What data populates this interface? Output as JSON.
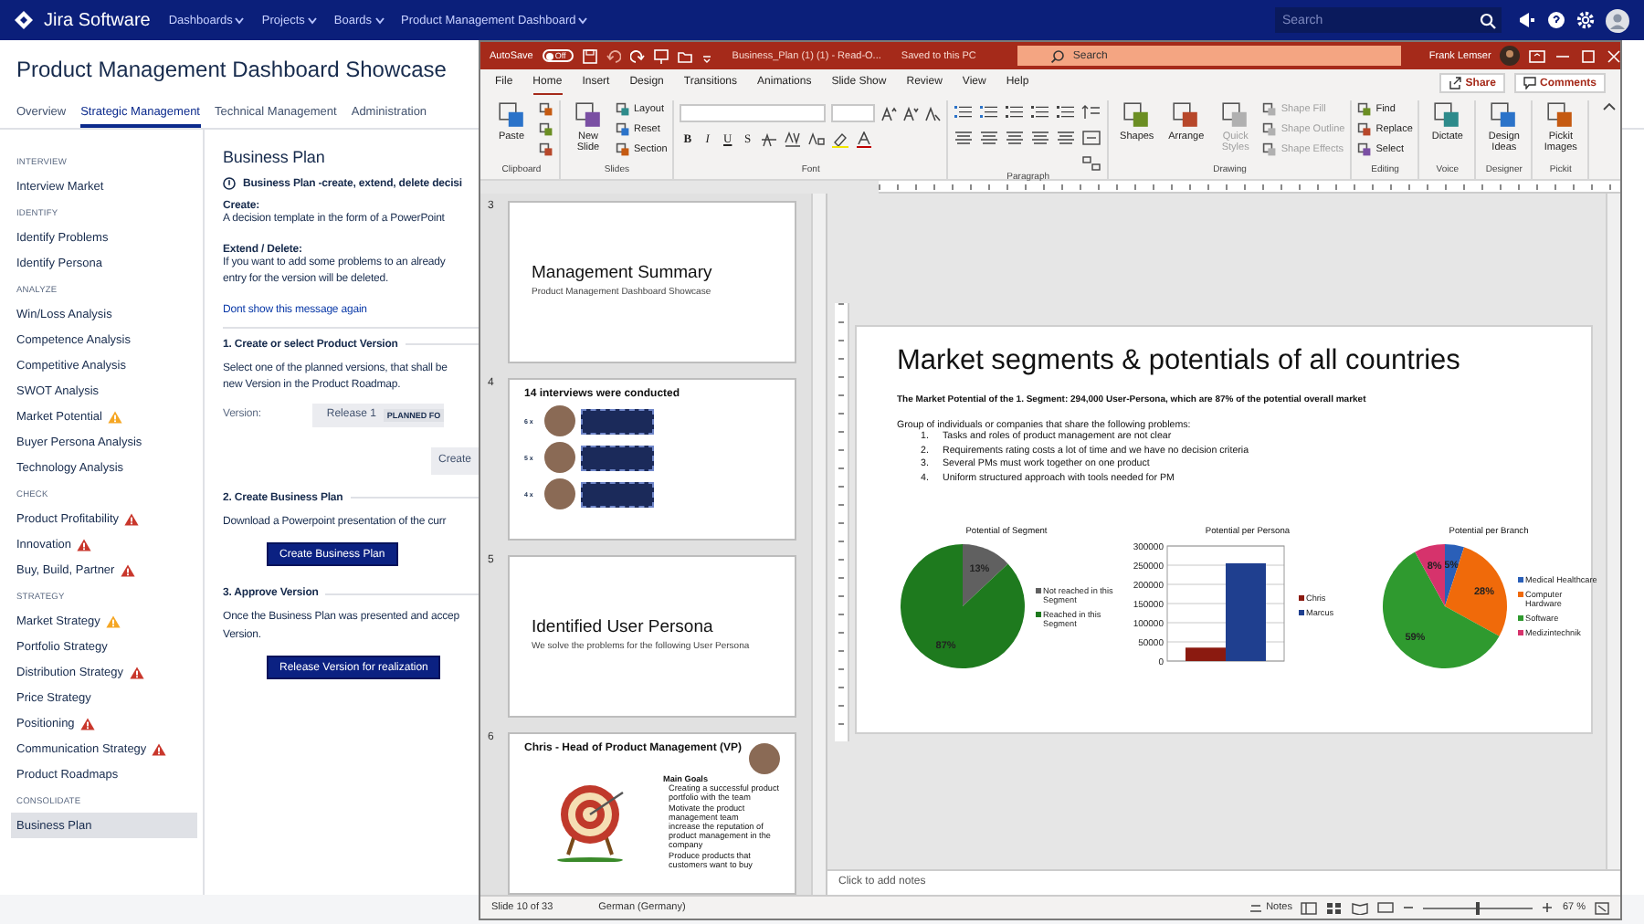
{
  "jira": {
    "header": {
      "logo": "Jira Software",
      "nav": [
        {
          "label": "Dashboards"
        },
        {
          "label": "Projects"
        },
        {
          "label": "Boards"
        },
        {
          "label": "Product Management Dashboard"
        }
      ],
      "search": {
        "placeholder": "Search"
      }
    },
    "page_title": "Product Management Dashboard Showcase",
    "tabs": [
      {
        "label": "Overview",
        "selected": false
      },
      {
        "label": "Strategic Management",
        "selected": true
      },
      {
        "label": "Technical Management",
        "selected": false
      },
      {
        "label": "Administration",
        "selected": false
      }
    ],
    "sidebar": {
      "sections": [
        {
          "heading": "INTERVIEW",
          "items": [
            {
              "label": "Interview Market",
              "selected": false
            }
          ]
        },
        {
          "heading": "IDENTIFY",
          "items": [
            {
              "label": "Identify Problems",
              "selected": false
            },
            {
              "label": "Identify Persona",
              "selected": false
            }
          ]
        },
        {
          "heading": "ANALYZE",
          "items": [
            {
              "label": "Win/Loss Analysis",
              "selected": false
            },
            {
              "label": "Competence Analysis",
              "selected": false
            },
            {
              "label": "Competitive Analysis",
              "selected": false
            },
            {
              "label": "SWOT Analysis",
              "selected": false
            },
            {
              "label": "Market Potential",
              "color": "#f5a623",
              "selected": false
            },
            {
              "label": "Buyer Persona Analysis",
              "selected": false
            },
            {
              "label": "Technology Analysis",
              "selected": false
            }
          ]
        },
        {
          "heading": "CHECK",
          "items": [
            {
              "label": "Product Profitability",
              "color": "#c9372c",
              "selected": false
            },
            {
              "label": "Innovation",
              "color": "#c9372c",
              "selected": false
            },
            {
              "label": "Buy, Build, Partner",
              "color": "#c9372c",
              "selected": false
            }
          ]
        },
        {
          "heading": "STRATEGY",
          "items": [
            {
              "label": "Market Strategy",
              "color": "#f5a623",
              "selected": false
            },
            {
              "label": "Portfolio Strategy",
              "selected": false
            },
            {
              "label": "Distribution Strategy",
              "color": "#c9372c",
              "selected": false
            },
            {
              "label": "Price Strategy",
              "selected": false
            },
            {
              "label": "Positioning",
              "color": "#c9372c",
              "selected": false
            },
            {
              "label": "Communication Strategy",
              "color": "#c9372c",
              "selected": false
            },
            {
              "label": "Product Roadmaps",
              "selected": false
            }
          ]
        },
        {
          "heading": "CONSOLIDATE",
          "items": [
            {
              "label": "Business Plan",
              "selected": true
            }
          ]
        }
      ]
    },
    "content": {
      "title": "Business Plan",
      "notice": {
        "heading": "Business Plan -create, extend, delete decisi",
        "paragraphs": [
          {
            "label": "Create:",
            "lines": [
              "A decision template in the form of a PowerPoint"
            ]
          },
          {
            "label": "Extend / Delete:",
            "lines": [
              "If you want to add some problems to an already",
              "entry for the version will be deleted."
            ]
          }
        ],
        "link": "Dont show this message again"
      },
      "steps": [
        {
          "kind": "version",
          "heading": "1. Create or select Product Version",
          "lines": [
            "Select one of the planned versions, that shall be",
            "new Version in the Product Roadmap."
          ],
          "version_label": "Version:",
          "version": "Release 1",
          "version_status": "PLANNED FO",
          "button": "Create"
        },
        {
          "kind": "action",
          "heading": "2. Create Business Plan",
          "lines": [
            "Download a Powerpoint presentation of the curr"
          ],
          "button": "Create Business Plan"
        },
        {
          "kind": "action",
          "heading": "3. Approve Version",
          "lines": [
            "Once the Business Plan was presented and accep",
            "Version."
          ],
          "button": "Release Version for realization"
        }
      ]
    }
  },
  "powerpoint": {
    "titlebar": {
      "autosave_label": "AutoSave",
      "autosave": {
        "on": false,
        "label": "Off"
      },
      "filename": "Business_Plan (1) (1) - Read-O...",
      "save_status": "Saved to this PC",
      "search": {
        "placeholder": "Search"
      },
      "user": "Frank Lemser"
    },
    "tabs": [
      {
        "label": "File",
        "selected": false
      },
      {
        "label": "Home",
        "selected": true
      },
      {
        "label": "Insert",
        "selected": false
      },
      {
        "label": "Design",
        "selected": false
      },
      {
        "label": "Transitions",
        "selected": false
      },
      {
        "label": "Animations",
        "selected": false
      },
      {
        "label": "Slide Show",
        "selected": false
      },
      {
        "label": "Review",
        "selected": false
      },
      {
        "label": "View",
        "selected": false
      },
      {
        "label": "Help",
        "selected": false
      }
    ],
    "share": "Share",
    "comments": "Comments",
    "ribbon": [
      {
        "label": "Clipboard",
        "kind": "buttons",
        "items": [
          {
            "kind": "large",
            "label": "Paste",
            "disabled": false
          },
          {
            "kind": "icon",
            "disabled": false
          },
          {
            "kind": "icon",
            "disabled": false
          },
          {
            "kind": "icon",
            "disabled": false
          }
        ]
      },
      {
        "label": "Slides",
        "kind": "buttons",
        "items": [
          {
            "kind": "large",
            "label": "New Slide",
            "disabled": false
          },
          {
            "kind": "small",
            "label": "Layout",
            "disabled": false
          },
          {
            "kind": "small",
            "label": "Reset",
            "disabled": false
          },
          {
            "kind": "small",
            "label": "Section",
            "disabled": false
          }
        ]
      },
      {
        "label": "Font",
        "kind": "font",
        "format_buttons": [
          "B",
          "I",
          "U",
          "S"
        ]
      },
      {
        "label": "Paragraph",
        "kind": "paragraph"
      },
      {
        "label": "Drawing",
        "kind": "buttons",
        "items": [
          {
            "kind": "large",
            "label": "Shapes",
            "disabled": false
          },
          {
            "kind": "large",
            "label": "Arrange",
            "disabled": false
          },
          {
            "kind": "large",
            "label": "Quick Styles",
            "disabled": true
          },
          {
            "kind": "small",
            "label": "Shape Fill",
            "disabled": true
          },
          {
            "kind": "small",
            "label": "Shape Outline",
            "disabled": true
          },
          {
            "kind": "small",
            "label": "Shape Effects",
            "disabled": true
          }
        ]
      },
      {
        "label": "Editing",
        "kind": "buttons",
        "items": [
          {
            "kind": "small",
            "label": "Find",
            "disabled": false
          },
          {
            "kind": "small",
            "label": "Replace",
            "disabled": false
          },
          {
            "kind": "small",
            "label": "Select",
            "disabled": false
          }
        ]
      },
      {
        "label": "Voice",
        "kind": "buttons",
        "items": [
          {
            "kind": "large",
            "label": "Dictate",
            "disabled": false
          }
        ]
      },
      {
        "label": "Designer",
        "kind": "buttons",
        "items": [
          {
            "kind": "large",
            "label": "Design Ideas",
            "disabled": false
          }
        ]
      },
      {
        "label": "Pickit",
        "kind": "buttons",
        "items": [
          {
            "kind": "large",
            "label": "Pickit Images",
            "disabled": false
          }
        ]
      }
    ],
    "thumbnails": [
      {
        "number": "3",
        "kind": "title",
        "title": "Management Summary",
        "subtitle": "Product Management Dashboard Showcase"
      },
      {
        "number": "4",
        "kind": "interviews",
        "title": "14 interviews were conducted",
        "rows": [
          {
            "count": "6 x"
          },
          {
            "count": "5 x"
          },
          {
            "count": "4 x"
          }
        ]
      },
      {
        "number": "5",
        "kind": "title",
        "title": "Identified User Persona",
        "subtitle": "We solve the problems for the following User Persona"
      },
      {
        "number": "6",
        "kind": "persona",
        "title": "Chris - Head of Product Management (VP)",
        "goals_heading": "Main Goals",
        "goals": [
          "Creating a successful product portfolio with the team",
          "Motivate the product management team",
          "increase the reputation of product management in the company",
          "Produce products that customers want to buy"
        ]
      }
    ],
    "slide": {
      "title": "Market segments & potentials of all countries",
      "subtitle": "The Market Potential of the 1. Segment: 294,000 User-Persona, which are 87% of the potential overall market",
      "intro": "Group of individuals or companies that share the following problems:",
      "problems": [
        {
          "number": "1.",
          "text": "Tasks and roles of product management are not clear"
        },
        {
          "number": "2.",
          "text": "Requirements rating costs a lot of time and we have no decision criteria"
        },
        {
          "number": "3.",
          "text": "Several PMs must work together on one product"
        },
        {
          "number": "4.",
          "text": "Uniform structured approach with tools needed for PM"
        }
      ],
      "charts": [
        {
          "chart_data": {
            "type": "pie",
            "title": "Potential of Segment",
            "categories": [
              "Not reached in this Segment",
              "Reached in this Segment"
            ],
            "values": [
              13,
              87
            ],
            "value_labels": [
              "13%",
              "87%"
            ],
            "legend": "right"
          }
        },
        {
          "chart_data": {
            "type": "bar",
            "title": "Potential per Persona",
            "series": [
              {
                "name": "Chris",
                "color": "#8b1a10",
                "values": [
                  35000
                ]
              },
              {
                "name": "Marcus",
                "color": "#1f3f8f",
                "values": [
                  255000
                ]
              }
            ],
            "ylim": [
              0,
              300000
            ],
            "yticks": [
              0,
              50000,
              100000,
              150000,
              200000,
              250000,
              300000
            ],
            "grid": true,
            "legend": "right"
          }
        },
        {
          "chart_data": {
            "type": "pie",
            "title": "Potential per Branch",
            "categories": [
              "Medical Healthcare",
              "Computer Hardware",
              "Software",
              "Medizintechnik"
            ],
            "values": [
              5,
              28,
              59,
              8
            ],
            "value_labels": [
              "5%",
              "28%",
              "59%",
              "8%"
            ],
            "legend": "right"
          }
        }
      ]
    },
    "notes_placeholder": "Click to add notes",
    "statusbar": {
      "slide_position": "Slide 10 of 33",
      "language": "German (Germany)",
      "notes": "Notes",
      "zoom": {
        "level": 0.5,
        "reading": "67 %"
      }
    }
  }
}
